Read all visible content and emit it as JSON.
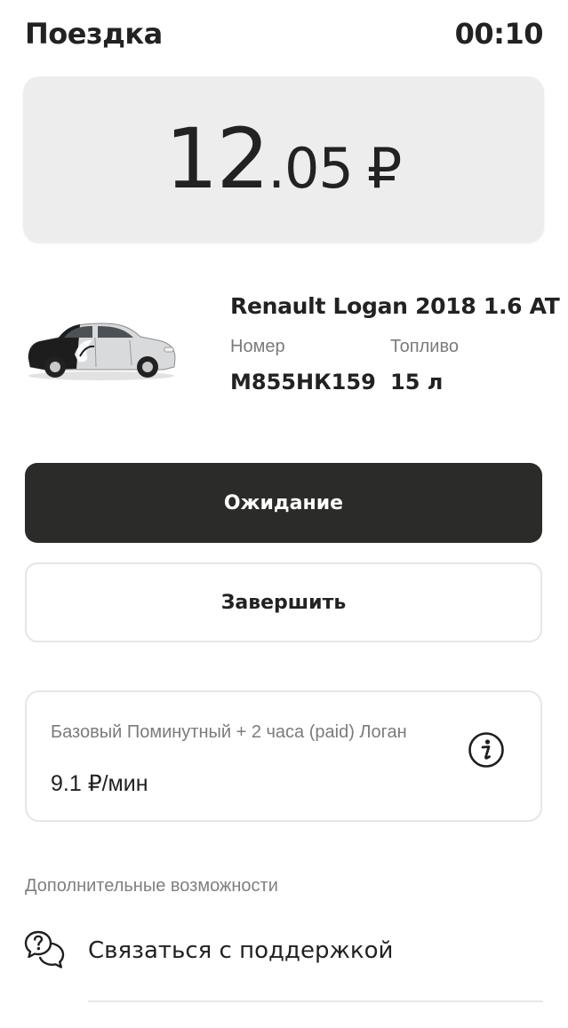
{
  "header": {
    "title": "Поездка",
    "timer": "00:10"
  },
  "price": {
    "integer": "12",
    "fraction": ".05",
    "currency": "₽"
  },
  "car": {
    "model": "Renault Logan 2018 1.6 AT",
    "plate_label": "Номер",
    "plate_value": "М855НК159",
    "fuel_label": "Топливо",
    "fuel_value": "15 л",
    "image": "car-photo"
  },
  "actions": {
    "wait_label": "Ожидание",
    "finish_label": "Завершить"
  },
  "tariff": {
    "name": "Базовый Поминутный + 2 часа (paid) Логан",
    "rate": "9.1 ₽/мин",
    "icon": "info-icon"
  },
  "extras": {
    "section_title": "Дополнительные возможности",
    "support_label": "Связаться с поддержкой",
    "support_icon": "chat-question-icon"
  },
  "colors": {
    "primary_button": "#2b2b29",
    "card_background": "#ededed",
    "border": "#e6e6e6",
    "secondary_text": "#7b7b7b"
  }
}
